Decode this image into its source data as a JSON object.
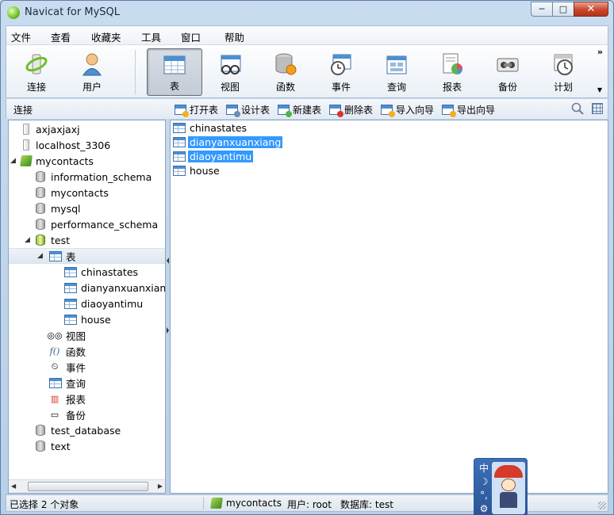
{
  "window": {
    "title": "Navicat for MySQL",
    "controls": {
      "minimize": "─",
      "maximize": "□",
      "close": "✕"
    }
  },
  "menu": [
    "文件",
    "查看",
    "收藏夹",
    "工具",
    "窗口",
    "帮助"
  ],
  "toolbar": {
    "buttons": [
      {
        "label": "连接",
        "icon": "connection-icon"
      },
      {
        "label": "用户",
        "icon": "user-icon"
      },
      {
        "label": "表",
        "icon": "table-icon",
        "active": true
      },
      {
        "label": "视图",
        "icon": "view-icon"
      },
      {
        "label": "函数",
        "icon": "function-icon"
      },
      {
        "label": "事件",
        "icon": "event-icon"
      },
      {
        "label": "查询",
        "icon": "query-icon"
      },
      {
        "label": "报表",
        "icon": "report-icon"
      },
      {
        "label": "备份",
        "icon": "backup-icon"
      },
      {
        "label": "计划",
        "icon": "schedule-icon"
      }
    ],
    "more": "»"
  },
  "subbar": {
    "label": "连接",
    "actions": [
      "打开表",
      "设计表",
      "新建表",
      "删除表",
      "导入向导",
      "导出向导"
    ]
  },
  "tree": {
    "connections": [
      "axjaxjaxj",
      "localhost_3306",
      "mycontacts"
    ],
    "databases": [
      "information_schema",
      "mycontacts",
      "mysql",
      "performance_schema",
      "test"
    ],
    "tables_folder": "表",
    "tables": [
      "chinastates",
      "dianyanxuanxiang",
      "diaoyantimu",
      "house"
    ],
    "objects": [
      "视图",
      "函数",
      "事件",
      "查询",
      "报表",
      "备份"
    ],
    "more_databases": [
      "test_database",
      "text"
    ]
  },
  "content": {
    "items": [
      {
        "label": "chinastates",
        "selected": false
      },
      {
        "label": "dianyanxuanxiang",
        "selected": true
      },
      {
        "label": "diaoyantimu",
        "selected": true
      },
      {
        "label": "house",
        "selected": false
      }
    ]
  },
  "status": {
    "selection": "已选择 2 个对象",
    "connection": "mycontacts",
    "user": "用户: root",
    "database": "数据库: test"
  },
  "ime": {
    "lang": "中",
    "moon": "☽",
    "punct": "°,",
    "gear": "⚙"
  },
  "colors": {
    "selection": "#3399ff",
    "title_bar": "#c9dcef",
    "close_button": "#c8462d"
  }
}
